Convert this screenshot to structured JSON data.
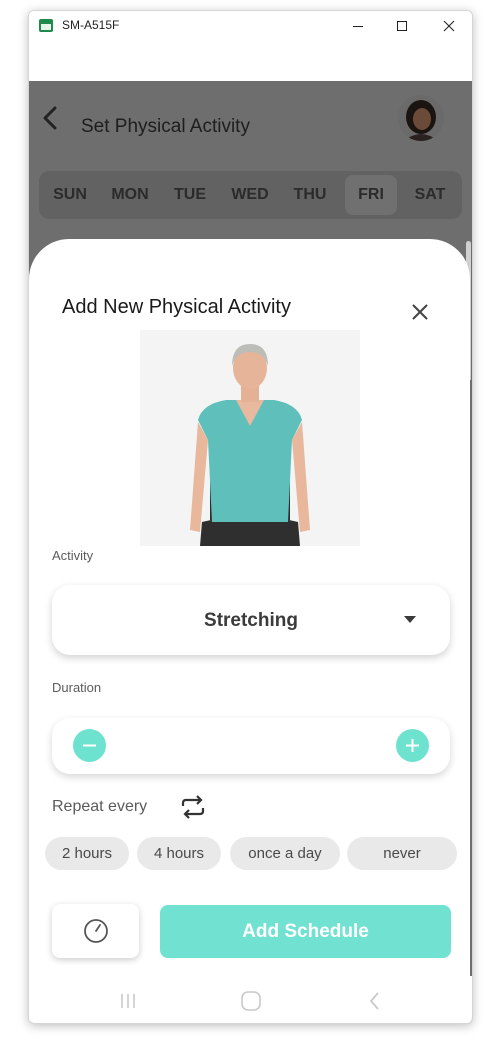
{
  "window": {
    "title": "SM-A515F",
    "controls": {
      "minimize": "minimize-icon",
      "maximize": "maximize-icon",
      "close": "close-icon"
    }
  },
  "app_bar": {
    "title": "Set Physical Activity",
    "back_icon": "chevron-left-icon",
    "avatar": "user-avatar"
  },
  "week_days": {
    "items": [
      "SUN",
      "MON",
      "TUE",
      "WED",
      "THU",
      "FRI",
      "SAT"
    ],
    "selected": "FRI"
  },
  "sheet": {
    "title": "Add New Physical Activity",
    "close_icon": "close-icon",
    "image": "activity-illustration",
    "activity_label": "Activity",
    "activity_value": "Stretching",
    "duration_label": "Duration",
    "decrement_icon": "minus-circle-icon",
    "increment_icon": "plus-circle-icon",
    "repeat_label": "Repeat every",
    "repeat_icon": "repeat-icon",
    "repeat_options": [
      "2 hours",
      "4 hours",
      "once a day",
      "never"
    ],
    "clock_icon": "clock-icon",
    "add_button": "Add Schedule"
  },
  "system_nav": [
    "recents-icon",
    "home-icon",
    "back-icon"
  ],
  "colors": {
    "accent": "#71e1d2",
    "stepper": "#6de2cf",
    "overlay": "#6e6e6e",
    "chip_bg": "#e9e9e9"
  }
}
